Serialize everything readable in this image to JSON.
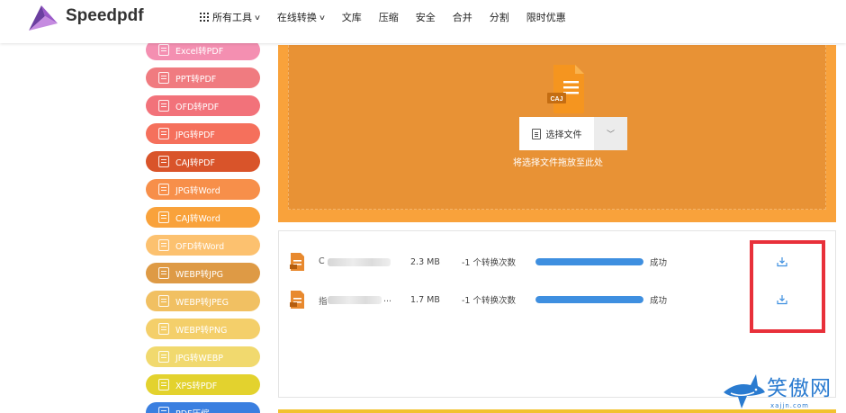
{
  "header": {
    "logo_text": "Speedpdf",
    "nav": [
      {
        "label": "所有工具",
        "has_apps_icon": true,
        "has_dropdown": true
      },
      {
        "label": "在线转换",
        "has_dropdown": true
      },
      {
        "label": "文库"
      },
      {
        "label": "压缩"
      },
      {
        "label": "安全"
      },
      {
        "label": "合并"
      },
      {
        "label": "分割"
      },
      {
        "label": "限时优惠"
      }
    ]
  },
  "sidebar": {
    "tools": [
      {
        "label": "Excel转PDF",
        "color": "#f48fb1"
      },
      {
        "label": "PPT转PDF",
        "color": "#f07b80"
      },
      {
        "label": "OFD转PDF",
        "color": "#f2727a"
      },
      {
        "label": "JPG转PDF",
        "color": "#f5705c"
      },
      {
        "label": "CAJ转PDF",
        "color": "#d9542a"
      },
      {
        "label": "JPG转Word",
        "color": "#f78f4a"
      },
      {
        "label": "CAJ转Word",
        "color": "#f9a23b"
      },
      {
        "label": "OFD转Word",
        "color": "#fcc16f"
      },
      {
        "label": "WEBP转JPG",
        "color": "#de9a45"
      },
      {
        "label": "WEBP转JPEG",
        "color": "#f1c062"
      },
      {
        "label": "WEBP转PNG",
        "color": "#f4cf6a"
      },
      {
        "label": "JPG转WEBP",
        "color": "#f1d96e"
      },
      {
        "label": "XPS转PDF",
        "color": "#e3d22e"
      },
      {
        "label": "PDF压缩",
        "color": "#3a7fe0"
      }
    ]
  },
  "upload": {
    "file_type_icon_text": "CAJ",
    "select_button_label": "选择文件",
    "drop_hint": "将选择文件拖放至此处"
  },
  "files": [
    {
      "name_visible": "C",
      "name_tail": "...",
      "size": "2.3 MB",
      "count": "-1 个转换次数",
      "progress": 100,
      "status": "成功"
    },
    {
      "name_visible": "指",
      "name_tail": "...",
      "size": "1.7 MB",
      "count": "-1 个转换次数",
      "progress": 100,
      "status": "成功"
    }
  ],
  "watermark": {
    "text": "笑傲网",
    "sub": "xajjn.com"
  },
  "colors": {
    "upload_bg": "#f9a23b",
    "upload_inner": "#e89235",
    "progress_fill": "#3e8fe0",
    "highlight": "#e8303a",
    "file_icon": "#e8892e"
  }
}
